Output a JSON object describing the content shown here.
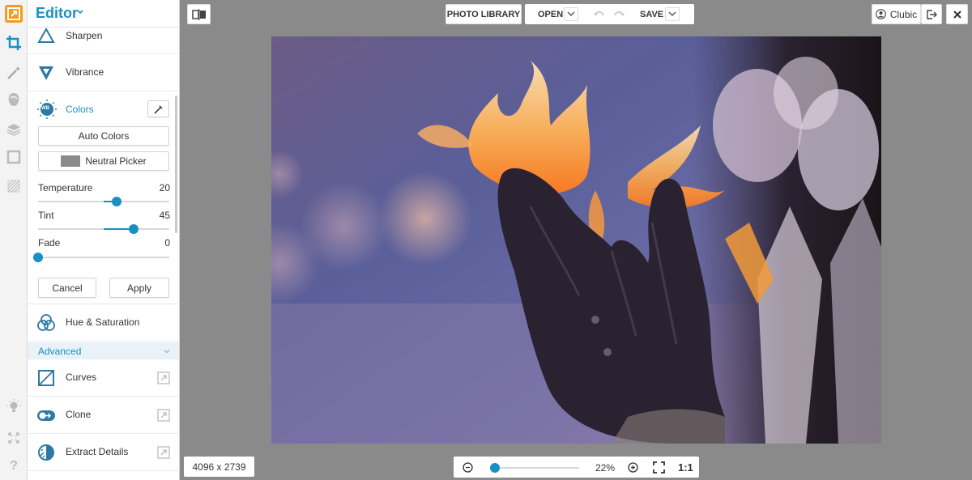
{
  "app": {
    "title": "Editor"
  },
  "rail": {
    "icons": [
      "logo-icon",
      "crop-icon",
      "magic-wand-icon",
      "face-icon",
      "layers-icon",
      "frame-icon",
      "texture-icon",
      "lightbulb-icon",
      "expand-icon",
      "help-icon"
    ],
    "help_label": "?"
  },
  "panel": {
    "tools_top": [
      {
        "label": "Sharpen",
        "icon": "triangle-icon"
      },
      {
        "label": "Vibrance",
        "icon": "vibrance-icon"
      }
    ],
    "colors": {
      "label": "Colors",
      "icon_text": "WB",
      "auto_label": "Auto Colors",
      "neutral_label": "Neutral Picker",
      "sliders": [
        {
          "label": "Temperature",
          "value": "20",
          "fraction": 0.6
        },
        {
          "label": "Tint",
          "value": "45",
          "fraction": 0.73
        },
        {
          "label": "Fade",
          "value": "0",
          "fraction": 0.0
        }
      ],
      "cancel_label": "Cancel",
      "apply_label": "Apply"
    },
    "hue_label": "Hue & Saturation",
    "advanced_label": "Advanced",
    "tools_advanced": [
      {
        "label": "Curves",
        "icon": "curves-icon"
      },
      {
        "label": "Clone",
        "icon": "clone-icon"
      },
      {
        "label": "Extract Details",
        "icon": "extract-icon"
      }
    ]
  },
  "toolbar": {
    "photo_library": "PHOTO LIBRARY",
    "open": "OPEN",
    "save": "SAVE",
    "user": "Clubic"
  },
  "status": {
    "dimensions": "4096 x 2739",
    "zoom": "22%",
    "zoom_fraction": 0.05,
    "actual_size": "1:1"
  },
  "colors": {
    "accent": "#1a8fc4",
    "brand": "#f39b1e"
  }
}
